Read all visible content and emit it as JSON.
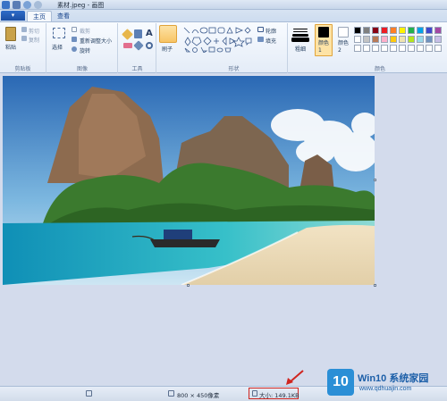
{
  "title": "素材.jpeg - 画图",
  "file_menu": "▾",
  "tabs": [
    "主页",
    "查看"
  ],
  "clipboard": {
    "paste": "粘贴",
    "cut": "剪切",
    "copy": "复制",
    "label": "剪贴板"
  },
  "image": {
    "select": "选择",
    "crop": "裁剪",
    "resize": "重新调整大小",
    "rotate": "旋转",
    "label": "图像"
  },
  "tools": {
    "label": "工具"
  },
  "brushes": {
    "label": "刷子"
  },
  "shapes": {
    "outline": "轮廓",
    "fill": "填充",
    "label": "形状"
  },
  "size": {
    "label": "粗细"
  },
  "colors": {
    "color1": "颜色 1",
    "color2": "颜色 2",
    "label": "颜色",
    "palette": [
      "#000000",
      "#7f7f7f",
      "#880015",
      "#ed1c24",
      "#ff7f27",
      "#fff200",
      "#22b14c",
      "#00a2e8",
      "#3f48cc",
      "#a349a4",
      "#ffffff",
      "#c3c3c3",
      "#b97a57",
      "#ffaec9",
      "#ffc90e",
      "#efe4b0",
      "#b5e61d",
      "#99d9ea",
      "#7092be",
      "#c8bfe7"
    ]
  },
  "status": {
    "dimensions": "800 × 450像素",
    "size": "大小: 149.1KB"
  },
  "watermark": {
    "logo": "10",
    "brand": "Win10 系统家园",
    "url": "www.qdhuajin.com"
  }
}
